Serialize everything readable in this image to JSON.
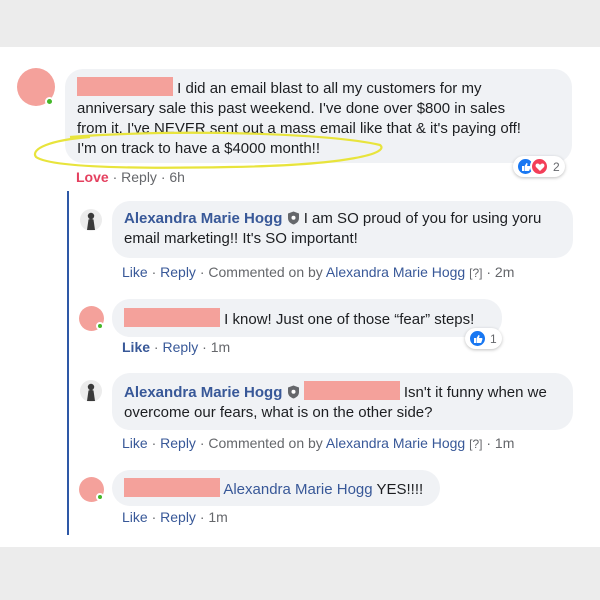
{
  "post_comment": {
    "text_line1": "I did an email blast to all my customers for my",
    "text_line2": "anniversary sale this past weekend. I've done over $800 in sales",
    "text_line3": "from it. I've NEVER sent out a mass email like that & it's paying off!",
    "text_line4": "I'm on track to have a $4000 month!!",
    "actions": {
      "love": "Love",
      "reply": "Reply",
      "time": "6h"
    },
    "reaction_count": "2"
  },
  "replies": [
    {
      "author": "Alexandra Marie Hogg",
      "text_line1": "I am SO proud of you for using yoru",
      "text_line2": "email marketing!! It's SO important!",
      "actions": {
        "like": "Like",
        "reply": "Reply",
        "commented_on": "Commented on by",
        "commenter": "Alexandra Marie Hogg",
        "help": "[?]",
        "time": "2m"
      }
    },
    {
      "text": "I know! Just one of those “fear” steps!",
      "actions": {
        "like": "Like",
        "reply": "Reply",
        "time": "1m"
      },
      "reaction_count": "1"
    },
    {
      "author": "Alexandra Marie Hogg",
      "text_line1": "Isn't it funny when we",
      "text_line2": "overcome our fears, what is on the other side?",
      "actions": {
        "like": "Like",
        "reply": "Reply",
        "commented_on": "Commented on by",
        "commenter": "Alexandra Marie Hogg",
        "help": "[?]",
        "time": "1m"
      }
    },
    {
      "tag": "Alexandra Marie Hogg",
      "text": "YES!!!!",
      "actions": {
        "like": "Like",
        "reply": "Reply",
        "time": "1m"
      }
    }
  ],
  "separator": "·",
  "colors": {
    "link": "#385898",
    "love": "#e4405f",
    "bubble": "#f0f2f5",
    "highlight": "#e8e43c",
    "redaction": "#f4a19b"
  }
}
